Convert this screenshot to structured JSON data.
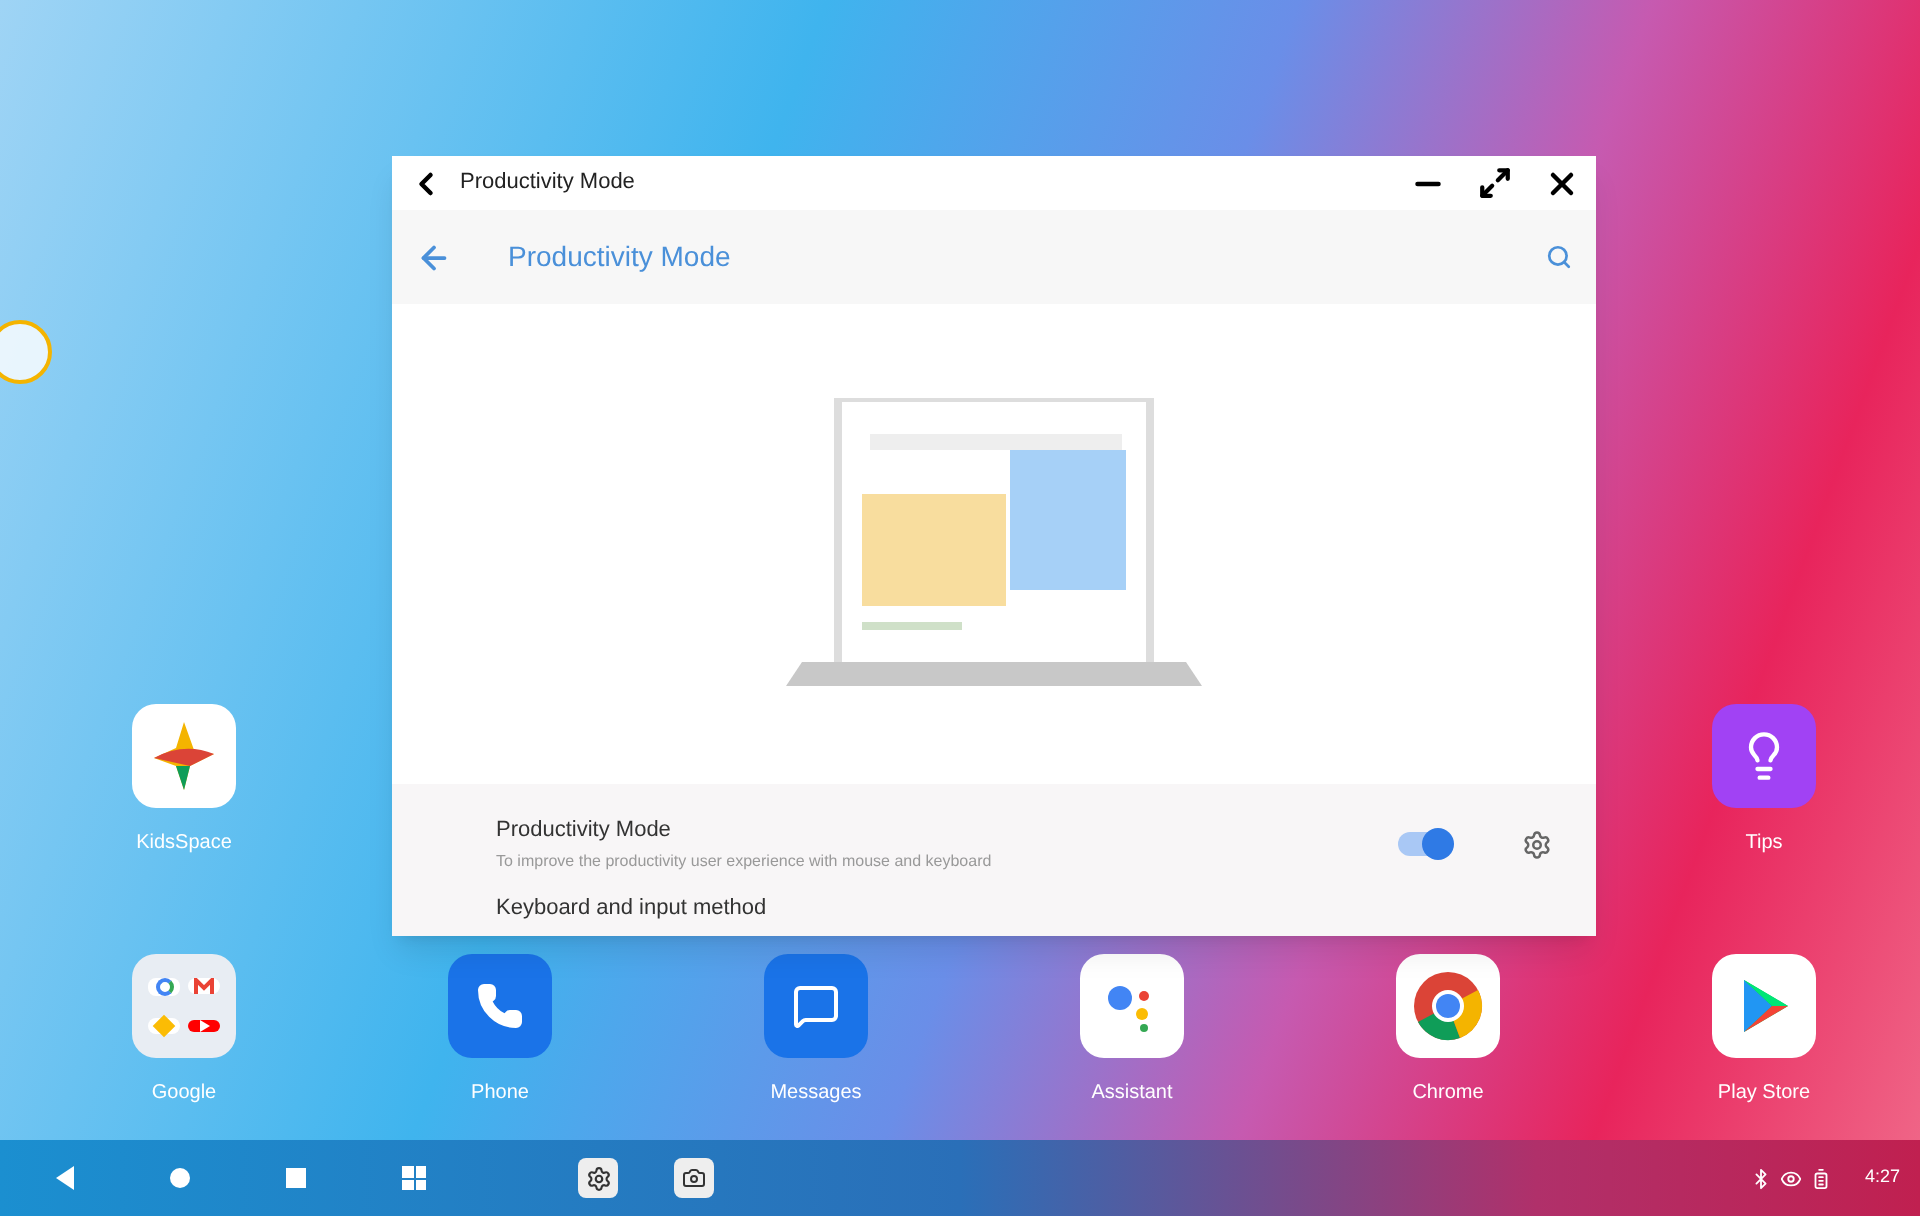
{
  "window": {
    "title": "Productivity Mode",
    "app_bar_title": "Productivity Mode",
    "settings": [
      {
        "kind": "toggle",
        "title": "Productivity Mode",
        "summary": "To improve the productivity user experience with mouse and keyboard",
        "on": true
      },
      {
        "kind": "link",
        "title": "Keyboard and input method"
      }
    ]
  },
  "desktop_side_apps": [
    {
      "kind": "kids",
      "label": "KidsSpace"
    },
    {
      "kind": "tips",
      "label": "Tips"
    }
  ],
  "dock_apps": [
    {
      "kind": "google",
      "label": "Google"
    },
    {
      "kind": "phone",
      "label": "Phone"
    },
    {
      "kind": "messages",
      "label": "Messages"
    },
    {
      "kind": "assistant",
      "label": "Assistant"
    },
    {
      "kind": "chrome",
      "label": "Chrome"
    },
    {
      "kind": "play",
      "label": "Play Store"
    }
  ],
  "taskbar": {
    "time": "4:27"
  }
}
